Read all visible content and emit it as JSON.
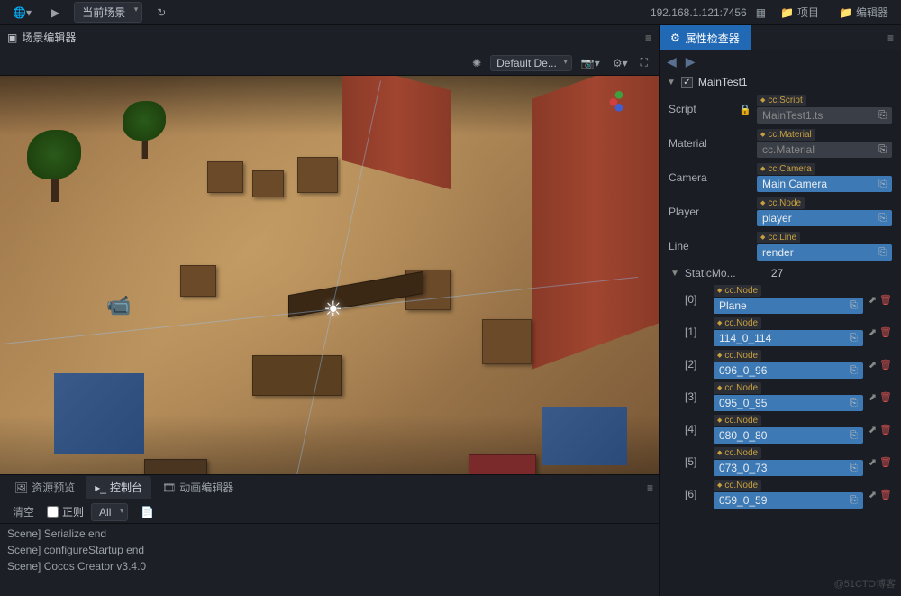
{
  "topbar": {
    "scene_dropdown": "当前场景",
    "ip": "192.168.1.121:7456",
    "btn_project": "项目",
    "btn_editor": "编辑器"
  },
  "scene_editor": {
    "title": "场景编辑器",
    "default_dropdown": "Default De..."
  },
  "bottom": {
    "tab_assets": "资源预览",
    "tab_console": "控制台",
    "tab_anim": "动画编辑器",
    "btn_clear": "清空",
    "chk_regex": "正则",
    "filter_all": "All",
    "logs": [
      "Scene] Serialize end",
      "Scene] configureStartup end",
      "Scene] Cocos Creator v3.4.0"
    ]
  },
  "inspector": {
    "title": "属性检查器",
    "component_name": "MainTest1",
    "props": [
      {
        "label": "Script",
        "type": "cc.Script",
        "value": "MainTest1.ts",
        "gray": true,
        "lock": true
      },
      {
        "label": "Material",
        "type": "cc.Material",
        "value": "cc.Material",
        "gray": true
      },
      {
        "label": "Camera",
        "type": "cc.Camera",
        "value": "Main Camera"
      },
      {
        "label": "Player",
        "type": "cc.Node",
        "value": "player"
      },
      {
        "label": "Line",
        "type": "cc.Line",
        "value": "render"
      }
    ],
    "array_prop": {
      "label": "StaticMo...",
      "count": "27",
      "items": [
        {
          "idx": "[0]",
          "type": "cc.Node",
          "value": "Plane"
        },
        {
          "idx": "[1]",
          "type": "cc.Node",
          "value": "114_0_114"
        },
        {
          "idx": "[2]",
          "type": "cc.Node",
          "value": "096_0_96"
        },
        {
          "idx": "[3]",
          "type": "cc.Node",
          "value": "095_0_95"
        },
        {
          "idx": "[4]",
          "type": "cc.Node",
          "value": "080_0_80"
        },
        {
          "idx": "[5]",
          "type": "cc.Node",
          "value": "073_0_73"
        },
        {
          "idx": "[6]",
          "type": "cc.Node",
          "value": "059_0_59"
        }
      ]
    }
  },
  "watermark": "@51CTO博客"
}
